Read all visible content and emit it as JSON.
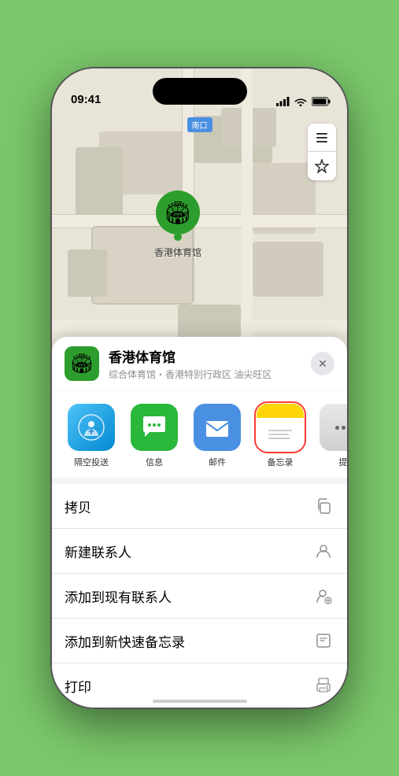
{
  "phone": {
    "time": "09:41",
    "map_label": "南口",
    "venue": {
      "name": "香港体育馆",
      "description": "综合体育馆・香港特别行政区 油尖旺区"
    },
    "share_apps": [
      {
        "id": "airdrop",
        "label": "隔空投送",
        "type": "airdrop"
      },
      {
        "id": "messages",
        "label": "信息",
        "type": "messages"
      },
      {
        "id": "mail",
        "label": "邮件",
        "type": "mail"
      },
      {
        "id": "notes",
        "label": "备忘录",
        "type": "notes",
        "selected": true
      },
      {
        "id": "more",
        "label": "提",
        "type": "more"
      }
    ],
    "actions": [
      {
        "id": "copy",
        "label": "拷贝",
        "icon": "copy"
      },
      {
        "id": "new-contact",
        "label": "新建联系人",
        "icon": "person"
      },
      {
        "id": "add-contact",
        "label": "添加到现有联系人",
        "icon": "person-add"
      },
      {
        "id": "add-notes",
        "label": "添加到新快速备忘录",
        "icon": "note"
      },
      {
        "id": "print",
        "label": "打印",
        "icon": "print"
      }
    ]
  }
}
